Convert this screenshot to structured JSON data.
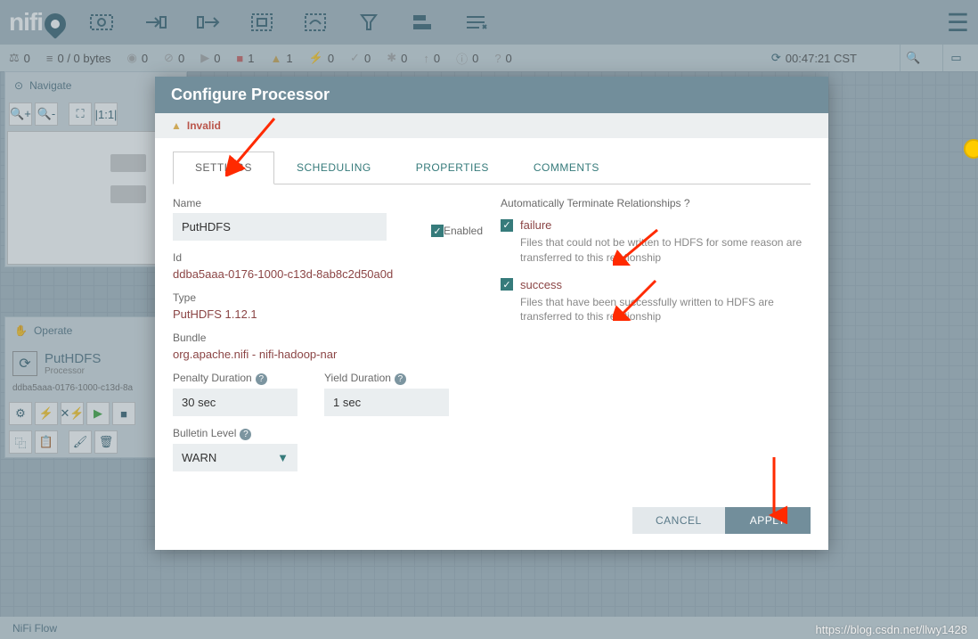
{
  "app": {
    "name_part1": "ni",
    "name_part2": "fi"
  },
  "status": {
    "flowfiles": "0",
    "queue": "0 / 0 bytes",
    "transmitting": "0",
    "not_transmitting": "0",
    "running": "0",
    "stopped": "1",
    "invalid": "1",
    "disabled": "0",
    "uptodate": "0",
    "locally_modified": "0",
    "stale": "0",
    "sync_failure": "0",
    "unknown": "0",
    "time": "00:47:21 CST"
  },
  "navigate": {
    "title": "Navigate"
  },
  "operate": {
    "title": "Operate",
    "processor_name": "PutHDFS",
    "processor_type": "Processor",
    "processor_id": "ddba5aaa-0176-1000-c13d-8a"
  },
  "modal": {
    "title": "Configure Processor",
    "invalid_label": "Invalid",
    "tabs": {
      "settings": "SETTINGS",
      "scheduling": "SCHEDULING",
      "properties": "PROPERTIES",
      "comments": "COMMENTS"
    },
    "settings": {
      "name_label": "Name",
      "name_value": "PutHDFS",
      "enabled_label": "Enabled",
      "id_label": "Id",
      "id_value": "ddba5aaa-0176-1000-c13d-8ab8c2d50a0d",
      "type_label": "Type",
      "type_value": "PutHDFS 1.12.1",
      "bundle_label": "Bundle",
      "bundle_value": "org.apache.nifi - nifi-hadoop-nar",
      "penalty_label": "Penalty Duration",
      "penalty_value": "30 sec",
      "yield_label": "Yield Duration",
      "yield_value": "1 sec",
      "bulletin_label": "Bulletin Level",
      "bulletin_value": "WARN"
    },
    "relationships": {
      "header": "Automatically Terminate Relationships",
      "items": [
        {
          "name": "failure",
          "desc": "Files that could not be written to HDFS for some reason are transferred to this relationship",
          "checked": true
        },
        {
          "name": "success",
          "desc": "Files that have been successfully written to HDFS are transferred to this relationship",
          "checked": true
        }
      ]
    },
    "buttons": {
      "cancel": "CANCEL",
      "apply": "APPLY"
    }
  },
  "footer": {
    "breadcrumb": "NiFi Flow"
  },
  "watermark": "https://blog.csdn.net/llwy1428"
}
